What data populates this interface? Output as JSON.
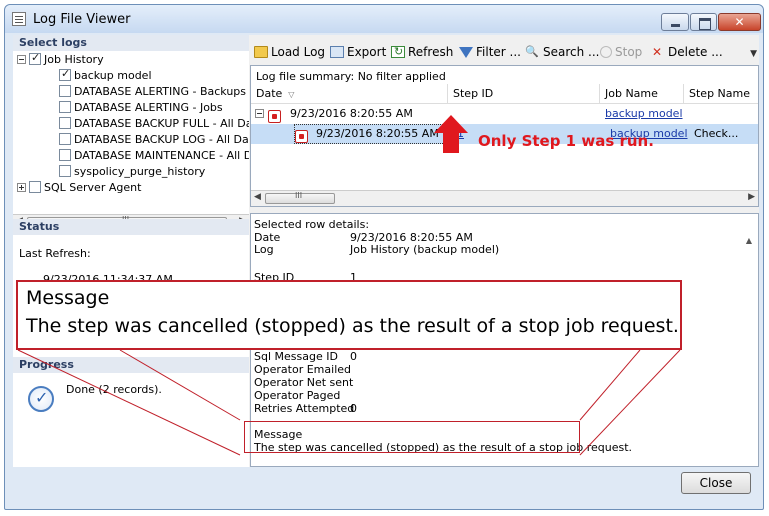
{
  "window": {
    "title": "Log File Viewer"
  },
  "left": {
    "select_logs_header": "Select logs",
    "tree": [
      {
        "label": "Job History",
        "checked": true
      },
      {
        "label": "backup model",
        "checked": true
      },
      {
        "label": "DATABASE ALERTING - Backups",
        "checked": false
      },
      {
        "label": "DATABASE ALERTING - Jobs",
        "checked": false
      },
      {
        "label": "DATABASE BACKUP FULL - All Dat",
        "checked": false
      },
      {
        "label": "DATABASE BACKUP LOG  - All Da",
        "checked": false
      },
      {
        "label": "DATABASE MAINTENANCE - All Da",
        "checked": false
      },
      {
        "label": "syspolicy_purge_history",
        "checked": false
      },
      {
        "label": "SQL Server Agent",
        "checked": false
      }
    ],
    "scroll_grip": "III",
    "status_header": "Status",
    "last_refresh_label": "Last Refresh:",
    "last_refresh_value": "9/23/2016 11:34:37 AM",
    "progress_header": "Progress",
    "progress_text": "Done (2 records)."
  },
  "toolbar": {
    "load_log": "Load Log",
    "export": "Export",
    "refresh": "Refresh",
    "filter": "Filter ...",
    "search": "Search ...",
    "stop": "Stop",
    "delete": "Delete ..."
  },
  "grid": {
    "summary": "Log file summary: No filter applied",
    "columns": [
      "Date",
      "Step ID",
      "Job Name",
      "Step Name"
    ],
    "rows": [
      {
        "date": "9/23/2016 8:20:55 AM",
        "step_id": "",
        "job_name": "backup model",
        "step_name": ""
      },
      {
        "date": "9/23/2016 8:20:55 AM",
        "step_id": "1",
        "job_name": "backup model",
        "step_name": "Check..."
      }
    ],
    "scroll_grip": "III"
  },
  "annotation": {
    "note": "Only Step 1 was run."
  },
  "details": {
    "header": "Selected row details:",
    "fields": [
      {
        "label": "Date",
        "value": "9/23/2016 8:20:55 AM"
      },
      {
        "label": "Log",
        "value": "Job History (backup model)"
      },
      {
        "label": "Step ID",
        "value": "1"
      },
      {
        "label": "Sql Message ID",
        "value": "0"
      },
      {
        "label": "Operator Emailed",
        "value": ""
      },
      {
        "label": "Operator Net sent",
        "value": ""
      },
      {
        "label": "Operator Paged",
        "value": ""
      },
      {
        "label": "Retries Attempted",
        "value": "0"
      }
    ],
    "message_label": "Message",
    "message_text": "The step was cancelled (stopped) as the result of a stop job request."
  },
  "callout": {
    "title": "Message",
    "text": "The step was cancelled (stopped) as the result of a stop job request."
  },
  "footer": {
    "close_label": "Close"
  },
  "colors": {
    "annotation_red": "#e0181e",
    "selection": "#c6ddf6"
  }
}
